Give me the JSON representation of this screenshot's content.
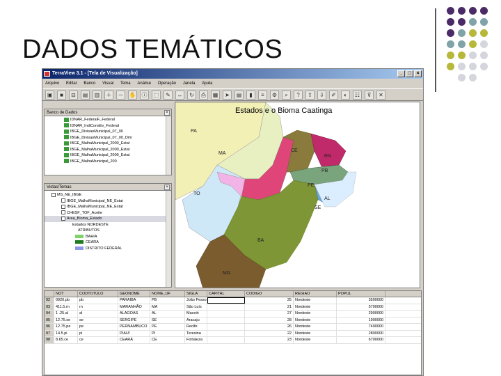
{
  "slide": {
    "title": "DADOS TEMÁTICOS"
  },
  "window": {
    "title": "TerraView 3.1 - [Tela de Visualização]",
    "minimize": "_",
    "maximize": "□",
    "close": "×",
    "menu": [
      "Arquivo",
      "Editar",
      "Banco",
      "Visual",
      "Tema",
      "Análise",
      "Operação",
      "Janela",
      "Ajuda"
    ]
  },
  "panels": {
    "database": {
      "header": "Banco de Dados",
      "items": [
        "IDNAR_FederalF_Federal",
        "IDNAR_IndiConsEv_Federal",
        "IBGE_DivisaoMunicipal_07_00",
        "IBGE_DivisaoMunicipal_07_00_Dim",
        "IBGE_MalhaMunicipal_2000_Estat",
        "IBGE_MalhaMunicipal_2000_Estat",
        "IBGE_MalhaMunicipal_2000_Estat",
        "IBGE_MalhaMunicipal_200"
      ]
    },
    "views": {
      "header": "Vistas/Temas",
      "items": [
        "MS_NE_IBGE",
        "IBGE_MalhaMunicipal_NE_Estat",
        "IBGE_MalhaMunicipal_NE_Estat",
        "CHESF_TOF_Aceite",
        "Area_Bioma_Estado",
        "Estados NORDESTE",
        "ATRIBUTOS"
      ],
      "legend": [
        {
          "label": "BAHIA",
          "color": "#7cd36a"
        },
        {
          "label": "CEARA",
          "color": "#1f7a1f"
        },
        {
          "label": "DISTRITO FEDERAL",
          "color": "#8f98e6"
        }
      ]
    }
  },
  "map": {
    "title": "Estados e o Bioma Caatinga",
    "labels": [
      "PA",
      "MA",
      "CE",
      "RN",
      "PB",
      "PE",
      "TO",
      "AL",
      "SE",
      "BA",
      "MG"
    ]
  },
  "table": {
    "columns": [
      "",
      "NOT",
      "CODTOTULO",
      "GEONOME",
      "NOME_UF",
      "SIGLA",
      "CAPITAL",
      "CODIGO",
      "REGIAO",
      "POPUL"
    ],
    "rows": [
      [
        "92",
        "0920.pb",
        "pb",
        "PARAIBA",
        "PB",
        "João Pessoa",
        "25",
        "Nordeste",
        "3500000"
      ],
      [
        "93",
        "411.5.rn",
        "rn",
        "MARANHÃO",
        "MA",
        "São Luís",
        "21",
        "Nordeste",
        "5700000"
      ],
      [
        "94",
        "1 .25.al",
        "al",
        "ALAGOAS",
        "AL",
        "Maceió",
        "27",
        "Nordeste",
        "2900000"
      ],
      [
        "95",
        "12.75.se",
        "se",
        "SERGIPE",
        "SE",
        "Aracaju",
        "28",
        "Nordeste",
        "1900000"
      ],
      [
        "96",
        "12.75.pe",
        "pe",
        "PERNAMBUCO",
        "PE",
        "Recife",
        "26",
        "Nordeste",
        "7400000"
      ],
      [
        "97",
        "14.5.pi",
        "pi",
        "PIAUÍ",
        "PI",
        "Teresina",
        "22",
        "Nordeste",
        "2800000"
      ],
      [
        "98",
        "8.65.ce",
        "ce",
        "CEARÁ",
        "CE",
        "Fortaleza",
        "23",
        "Nordeste",
        "6700000"
      ]
    ]
  },
  "colors": {
    "dot_purple": "#4b2a68",
    "dot_teal": "#7fa3a7",
    "dot_olive": "#b7b83a",
    "dot_gray": "#d5d5de"
  }
}
